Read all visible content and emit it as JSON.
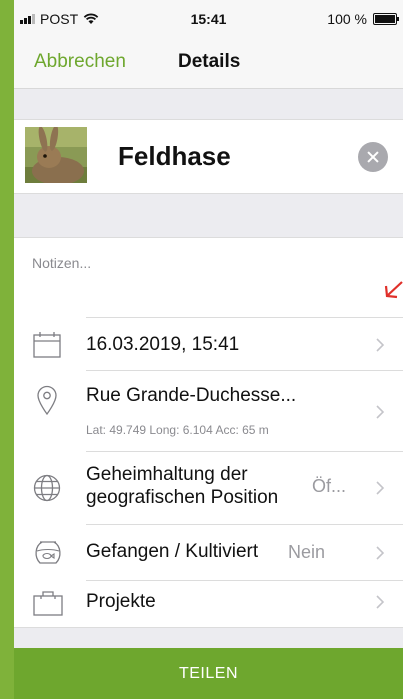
{
  "status_bar": {
    "carrier": "POST",
    "time": "15:41",
    "battery": "100 %"
  },
  "nav": {
    "cancel_label": "Abbrechen",
    "title": "Details"
  },
  "species": {
    "name": "Feldhase"
  },
  "notes": {
    "placeholder": "Notizen..."
  },
  "rows": {
    "date": {
      "label": "16.03.2019, 15:41"
    },
    "location": {
      "label": "Rue Grande-Duchesse...",
      "coords": "Lat: 49.749  Long: 6.104  Acc: 65 m"
    },
    "privacy": {
      "label_line1": "Geheimhaltung der",
      "label_line2": "geografischen Position",
      "value": "Öf..."
    },
    "captive": {
      "label": "Gefangen / Kultiviert",
      "value": "Nein"
    },
    "projects": {
      "label": "Projekte"
    }
  },
  "share_button": {
    "label": "TEILEN"
  },
  "colors": {
    "accent": "#6ea72e",
    "frame": "#7fb23a",
    "annotation_arrow": "#e0302a"
  }
}
